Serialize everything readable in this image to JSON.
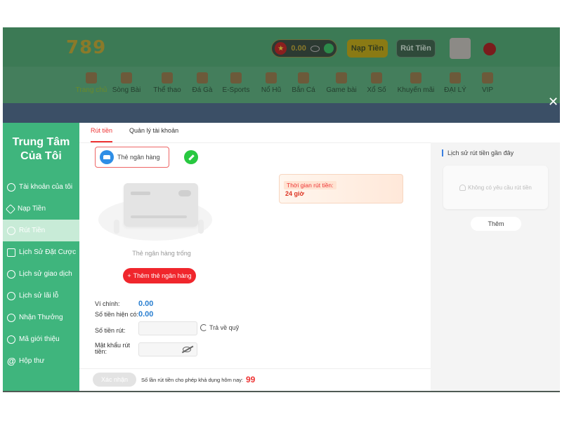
{
  "site": {
    "logo": "789",
    "balance": "0.00",
    "deposit_label": "Nạp Tiền",
    "withdraw_label": "Rút Tiền",
    "nav": [
      {
        "label": "Trang chủ",
        "active": true
      },
      {
        "label": "Sòng Bài"
      },
      {
        "label": "Thể thao"
      },
      {
        "label": "Đá Gà"
      },
      {
        "label": "E-Sports"
      },
      {
        "label": "Nổ Hũ"
      },
      {
        "label": "Bắn Cá"
      },
      {
        "label": "Game bài"
      },
      {
        "label": "Xổ Số"
      },
      {
        "label": "Khuyến mãi"
      },
      {
        "label": "ĐẠI LÝ"
      },
      {
        "label": "VIP"
      }
    ]
  },
  "sidebar": {
    "title_line1": "Trung Tâm",
    "title_line2": "Của Tôi",
    "items": [
      {
        "label": "Tài khoản của tôi",
        "icon": "user-circle-icon"
      },
      {
        "label": "Nạp Tiền",
        "icon": "diamond-icon"
      },
      {
        "label": "Rút Tiền",
        "icon": "withdraw-icon",
        "active": true
      },
      {
        "label": "Lịch Sử Đặt Cược",
        "icon": "clipboard-icon"
      },
      {
        "label": "Lịch sử giao dịch",
        "icon": "transaction-icon"
      },
      {
        "label": "Lịch sử lãi lỗ",
        "icon": "profit-loss-icon"
      },
      {
        "label": "Nhận Thưởng",
        "icon": "gift-icon"
      },
      {
        "label": "Mã giới thiệu",
        "icon": "referral-icon"
      },
      {
        "label": "Hộp thư",
        "icon": "at-icon"
      }
    ]
  },
  "tabs": [
    {
      "label": "Rút tiền",
      "active": true
    },
    {
      "label": "Quản lý tài khoản"
    }
  ],
  "bank_card": {
    "selector_label": "Thẻ ngân hàng",
    "empty_text": "Thẻ ngân hàng trống",
    "add_button": "Thêm thẻ ngân hàng"
  },
  "wallet": {
    "main_label": "Ví chính:",
    "main_value": "0.00",
    "available_label": "Số tiền hiện có:",
    "available_value": "0.00",
    "amount_label": "Số tiền rút:",
    "return_label": "Trả về quỹ",
    "password_label_1": "Mật khẩu rút",
    "password_label_2": "tiền:"
  },
  "withdraw_time": {
    "title": "Thời gian rút tiền:",
    "value": "24 giờ"
  },
  "footer": {
    "confirm_label": "Xác nhận",
    "limit_text": "Số lần rút tiền cho phép khả dụng hôm nay:",
    "limit_value": "99"
  },
  "history": {
    "title": "Lịch sử rút tiền gần đây",
    "empty_text": "Không có yêu cầu rút tiền",
    "more_label": "Thêm"
  },
  "colors": {
    "sidebar_green": "#3fb57d",
    "accent_red": "#f0262c",
    "value_blue": "#2a7fd0"
  }
}
